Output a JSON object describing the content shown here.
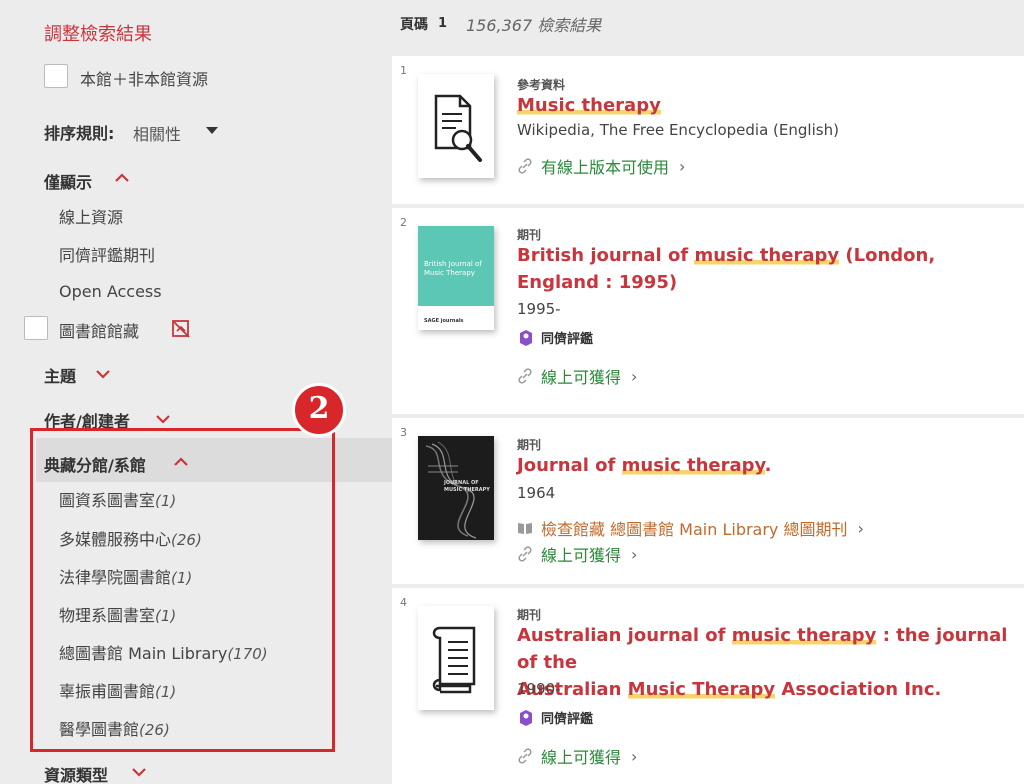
{
  "sidebar": {
    "refine_title": "調整檢索結果",
    "expand_checkbox_label": "本館＋非本館資源",
    "sort": {
      "label": "排序規則:",
      "value": "相關性"
    },
    "show_only": {
      "title": "僅顯示",
      "items": [
        "線上資源",
        "同儕評鑑期刊",
        "Open Access"
      ],
      "library_checkbox_label": "圖書館館藏"
    },
    "subject_title": "主題",
    "author_title": "作者/創建者",
    "location": {
      "title": "典藏分館/系館",
      "items": [
        {
          "name": "圖資系圖書室",
          "count": "(1)"
        },
        {
          "name": "多媒體服務中心",
          "count": "(26)"
        },
        {
          "name": "法律學院圖書館",
          "count": "(1)"
        },
        {
          "name": "物理系圖書室",
          "count": "(1)"
        },
        {
          "name": "總圖書館 Main Library",
          "count": "(170)"
        },
        {
          "name": "辜振甫圖書館",
          "count": "(1)"
        },
        {
          "name": "醫學圖書館",
          "count": "(26)"
        }
      ]
    },
    "resource_type_title": "資源類型",
    "callout_number": "2"
  },
  "main": {
    "page_label": "頁碼",
    "page_number": "1",
    "result_count": "156,367 檢索結果",
    "results": [
      {
        "index": "1",
        "type": "參考資料",
        "title_parts": [
          "",
          "Music therapy",
          ""
        ],
        "source": "Wikipedia, The Free Encyclopedia (English)",
        "link": "有線上版本可使用",
        "thumb_icon": "document-search-icon"
      },
      {
        "index": "2",
        "type": "期刊",
        "title_parts": [
          "British journal of ",
          "music therapy",
          " (London, England : 1995)"
        ],
        "date": "1995-",
        "peer": "同儕評鑑",
        "link": "線上可獲得",
        "thumb_title": "British Journal of Music Therapy",
        "thumb_publisher": "SAGE journals"
      },
      {
        "index": "3",
        "type": "期刊",
        "title_parts": [
          "Journal of ",
          "music therapy",
          "."
        ],
        "date": "1964",
        "holding": "檢查館藏 總圖書館 Main Library  總圖期刊",
        "link": "線上可獲得",
        "thumb_title": "JOURNAL OF MUSIC THERAPY"
      },
      {
        "index": "4",
        "type": "期刊",
        "title_line1_parts": [
          "Australian journal of ",
          "music therapy",
          " : the journal of the"
        ],
        "title_line2_parts": [
          "Australian ",
          "Music Therapy",
          " Association Inc."
        ],
        "date": "1990-",
        "peer": "同儕評鑑",
        "link": "線上可獲得",
        "thumb_icon": "open-book-icon"
      }
    ]
  },
  "colors": {
    "accent_red": "#c8363d",
    "link_green": "#2a8a3a",
    "holding_orange": "#c06a2b",
    "highlight_yellow": "#f4d56a",
    "callout_red": "#d7272b"
  }
}
